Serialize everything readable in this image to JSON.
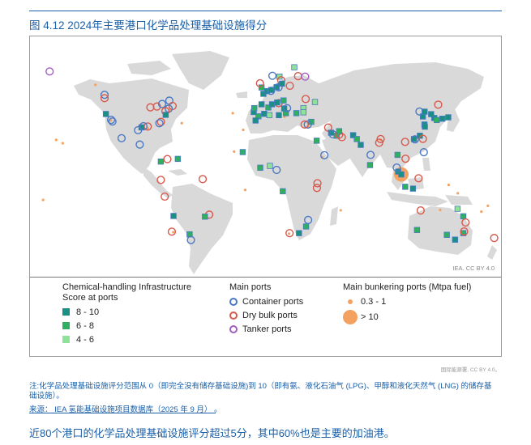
{
  "figure": {
    "title": "图 4.12 2024年主要港口化学品处理基础设施得分",
    "credit": "IEA. CC BY 4.0",
    "source_small": "国际能源署, CC BY 4.0。",
    "note": "注:化学品处理基础设施评分范围从 0（即完全没有储存基础设施)到 10（即有氨、液化石油气 (LPG)、甲醇和液化天然气 (LNG) 的储存基础设施）。",
    "source_label": "来源：",
    "source_link": "IEA 氢能基础设施项目数据库（2025 年 9 月）",
    "source_end": "。",
    "summary": "近80个港口的化学品处理基础设施评分超过5分，其中60%也是主要的加油港。"
  },
  "colors": {
    "land": "#d9d9d9",
    "score_high": "#1a8f83",
    "score_mid": "#2fb05e",
    "score_low": "#8fe29a",
    "container": "#4a79c4",
    "dry_bulk": "#d9584b",
    "tanker": "#a35cc4",
    "bunkering": "#f4a261"
  },
  "legend": {
    "score": {
      "title": "Chemical-handling Infrastructure Score at ports",
      "items": [
        "8 - 10",
        "6 - 8",
        "4 - 6"
      ]
    },
    "ports": {
      "title": "Main ports",
      "items": [
        "Container ports",
        "Dry bulk ports",
        "Tanker ports"
      ]
    },
    "bunkering": {
      "title": "Main bunkering ports (Mtpa fuel)",
      "items": [
        "0.3 - 1",
        "> 10"
      ]
    }
  },
  "map_markers": {
    "ports": [
      {
        "type": "tanker",
        "lon": -165,
        "lat": 63
      },
      {
        "type": "container",
        "lon": -123,
        "lat": 49
      },
      {
        "type": "dry_bulk",
        "lon": -123,
        "lat": 47
      },
      {
        "type": "score_high",
        "lon": -122,
        "lat": 37.5
      },
      {
        "type": "container",
        "lon": -118,
        "lat": 34
      },
      {
        "type": "container",
        "lon": -117,
        "lat": 33
      },
      {
        "type": "container",
        "lon": -110,
        "lat": 23
      },
      {
        "type": "dry_bulk",
        "lon": -88,
        "lat": 41.5
      },
      {
        "type": "dry_bulk",
        "lon": -83,
        "lat": 42
      },
      {
        "type": "container",
        "lon": -79,
        "lat": 43.5
      },
      {
        "type": "container",
        "lon": -73.5,
        "lat": 45.5
      },
      {
        "type": "dry_bulk",
        "lon": -71,
        "lat": 42.3
      },
      {
        "type": "container",
        "lon": -74,
        "lat": 40.7
      },
      {
        "type": "dry_bulk",
        "lon": -76.5,
        "lat": 39.2
      },
      {
        "type": "score_high",
        "lon": -76.3,
        "lat": 37
      },
      {
        "type": "dry_bulk",
        "lon": -79.9,
        "lat": 32.8
      },
      {
        "type": "container",
        "lon": -81.1,
        "lat": 32
      },
      {
        "type": "dry_bulk",
        "lon": -90,
        "lat": 30
      },
      {
        "type": "score_high",
        "lon": -94.8,
        "lat": 29.5
      },
      {
        "type": "container",
        "lon": -97.4,
        "lat": 27.8
      },
      {
        "type": "container",
        "lon": -93.3,
        "lat": 30.2
      },
      {
        "type": "container",
        "lon": -96.1,
        "lat": 19.2
      },
      {
        "type": "score_mid",
        "lon": -80,
        "lat": 9
      },
      {
        "type": "dry_bulk",
        "lon": -75,
        "lat": 10.5
      },
      {
        "type": "score_mid",
        "lon": -67,
        "lat": 10.6
      },
      {
        "type": "dry_bulk",
        "lon": -80,
        "lat": -2
      },
      {
        "type": "dry_bulk",
        "lon": -48,
        "lat": -1.5
      },
      {
        "type": "dry_bulk",
        "lon": -77,
        "lat": -12
      },
      {
        "type": "score_high",
        "lon": -70.3,
        "lat": -23.6
      },
      {
        "type": "dry_bulk",
        "lon": -71.6,
        "lat": -33
      },
      {
        "type": "dry_bulk",
        "lon": -43,
        "lat": -22.8
      },
      {
        "type": "score_mid",
        "lon": -46.3,
        "lat": -24
      },
      {
        "type": "score_mid",
        "lon": -58,
        "lat": -34.6
      },
      {
        "type": "container",
        "lon": -57,
        "lat": -38
      },
      {
        "type": "score_high",
        "lon": -9,
        "lat": 38.7
      },
      {
        "type": "score_mid",
        "lon": -8.6,
        "lat": 41
      },
      {
        "type": "score_high",
        "lon": -3,
        "lat": 43.3
      },
      {
        "type": "score_mid",
        "lon": -5.4,
        "lat": 36.1
      },
      {
        "type": "score_high",
        "lon": -1,
        "lat": 37.6
      },
      {
        "type": "score_mid",
        "lon": 2.2,
        "lat": 41.4
      },
      {
        "type": "score_high",
        "lon": 5,
        "lat": 43.3
      },
      {
        "type": "score_high",
        "lon": -1.6,
        "lat": 49.6
      },
      {
        "type": "score_high",
        "lon": 1.2,
        "lat": 51.2
      },
      {
        "type": "score_high",
        "lon": 4.4,
        "lat": 51.9
      },
      {
        "type": "container",
        "lon": 4.2,
        "lat": 51.4
      },
      {
        "type": "score_high",
        "lon": 8.5,
        "lat": 53.6
      },
      {
        "type": "container",
        "lon": 10,
        "lat": 53.5
      },
      {
        "type": "score_mid",
        "lon": -3,
        "lat": 53.4
      },
      {
        "type": "dry_bulk",
        "lon": -4.2,
        "lat": 55.9
      },
      {
        "type": "container",
        "lon": 5.3,
        "lat": 60.4
      },
      {
        "type": "score_low",
        "lon": 10.7,
        "lat": 59.9
      },
      {
        "type": "dry_bulk",
        "lon": 12,
        "lat": 57.7
      },
      {
        "type": "score_high",
        "lon": 12.6,
        "lat": 55.7
      },
      {
        "type": "dry_bulk",
        "lon": 18.6,
        "lat": 54.4
      },
      {
        "type": "dry_bulk",
        "lon": 24.9,
        "lat": 60.2
      },
      {
        "type": "tanker",
        "lon": 30.3,
        "lat": 59.9
      },
      {
        "type": "score_low",
        "lon": 22,
        "lat": 65.5
      },
      {
        "type": "dry_bulk",
        "lon": 10,
        "lat": 44
      },
      {
        "type": "score_high",
        "lon": 8.9,
        "lat": 44.4
      },
      {
        "type": "score_mid",
        "lon": 13.8,
        "lat": 45.6
      },
      {
        "type": "score_high",
        "lon": 14.3,
        "lat": 40.8
      },
      {
        "type": "score_mid",
        "lon": 15.6,
        "lat": 38
      },
      {
        "type": "container",
        "lon": 16.5,
        "lat": 41
      },
      {
        "type": "score_mid",
        "lon": 23.6,
        "lat": 38
      },
      {
        "type": "score_low",
        "lon": 29,
        "lat": 41
      },
      {
        "type": "score_low",
        "lon": 29,
        "lat": 38.5
      },
      {
        "type": "dry_bulk",
        "lon": 30.7,
        "lat": 46.5
      },
      {
        "type": "score_low",
        "lon": 37.8,
        "lat": 44.7
      },
      {
        "type": "score_mid",
        "lon": 35,
        "lat": 32.8
      },
      {
        "type": "container",
        "lon": 32.3,
        "lat": 31.2
      },
      {
        "type": "dry_bulk",
        "lon": 29.9,
        "lat": 31.2
      },
      {
        "type": "score_mid",
        "lon": 39.1,
        "lat": 21.5
      },
      {
        "type": "container",
        "lon": 45,
        "lat": 12.8
      },
      {
        "type": "score_low",
        "lon": 3,
        "lat": 36.8
      },
      {
        "type": "score_high",
        "lon": 10.2,
        "lat": 36.8
      },
      {
        "type": "score_high",
        "lon": -7.6,
        "lat": 33.6
      },
      {
        "type": "score_mid",
        "lon": -17.4,
        "lat": 14.7
      },
      {
        "type": "score_low",
        "lon": 3.4,
        "lat": 6.4
      },
      {
        "type": "score_mid",
        "lon": -4,
        "lat": 5.3
      },
      {
        "type": "dry_bulk",
        "lon": 39.7,
        "lat": -4
      },
      {
        "type": "dry_bulk",
        "lon": 39.3,
        "lat": -6.8
      },
      {
        "type": "container",
        "lon": 8.5,
        "lat": 4
      },
      {
        "type": "score_mid",
        "lon": 13.2,
        "lat": -8.8
      },
      {
        "type": "dry_bulk",
        "lon": 18.4,
        "lat": -33.9
      },
      {
        "type": "score_high",
        "lon": 25.6,
        "lat": -33.9
      },
      {
        "type": "score_mid",
        "lon": 31,
        "lat": -29.9
      },
      {
        "type": "container",
        "lon": 32.6,
        "lat": -26
      },
      {
        "type": "dry_bulk",
        "lon": 47.9,
        "lat": 29.4
      },
      {
        "type": "score_high",
        "lon": 50.1,
        "lat": 26.3
      },
      {
        "type": "container",
        "lon": 51.5,
        "lat": 25.3
      },
      {
        "type": "score_mid",
        "lon": 54.4,
        "lat": 24.5
      },
      {
        "type": "dry_bulk",
        "lon": 56.3,
        "lat": 25.1
      },
      {
        "type": "dry_bulk",
        "lon": 58.4,
        "lat": 23.6
      },
      {
        "type": "score_mid",
        "lon": 56.3,
        "lat": 27.2
      },
      {
        "type": "score_high",
        "lon": 67,
        "lat": 24.8
      },
      {
        "type": "score_high",
        "lon": 72.8,
        "lat": 19
      },
      {
        "type": "score_mid",
        "lon": 69.8,
        "lat": 22.5
      },
      {
        "type": "container",
        "lon": 80.3,
        "lat": 13
      },
      {
        "type": "dry_bulk",
        "lon": 86.9,
        "lat": 20.3
      },
      {
        "type": "dry_bulk",
        "lon": 88,
        "lat": 22.5
      },
      {
        "type": "score_mid",
        "lon": 79.9,
        "lat": 6.9
      },
      {
        "type": "score_high",
        "lon": 101.4,
        "lat": 3
      },
      {
        "type": "container",
        "lon": 100.3,
        "lat": 5.4
      },
      {
        "type": "score_high",
        "lon": 103.8,
        "lat": 1.3
      },
      {
        "type": "score_mid",
        "lon": 100.9,
        "lat": 13
      },
      {
        "type": "dry_bulk",
        "lon": 107,
        "lat": 10.7
      },
      {
        "type": "dry_bulk",
        "lon": 106.7,
        "lat": 20.8
      },
      {
        "type": "score_high",
        "lon": 113.5,
        "lat": 22.5
      },
      {
        "type": "container",
        "lon": 114.2,
        "lat": 22.3
      },
      {
        "type": "score_high",
        "lon": 118,
        "lat": 24.5
      },
      {
        "type": "score_high",
        "lon": 121.5,
        "lat": 31.2
      },
      {
        "type": "score_high",
        "lon": 121.8,
        "lat": 29.9
      },
      {
        "type": "score_high",
        "lon": 120.3,
        "lat": 36
      },
      {
        "type": "container",
        "lon": 117.7,
        "lat": 39
      },
      {
        "type": "score_high",
        "lon": 121.6,
        "lat": 38.9
      },
      {
        "type": "score_high",
        "lon": 129,
        "lat": 35.1
      },
      {
        "type": "score_high",
        "lon": 126.6,
        "lat": 37.4
      },
      {
        "type": "score_high",
        "lon": 135.2,
        "lat": 34.7
      },
      {
        "type": "score_high",
        "lon": 139.7,
        "lat": 35.5
      },
      {
        "type": "score_mid",
        "lon": 130.9,
        "lat": 33.9
      },
      {
        "type": "container",
        "lon": 121,
        "lat": 14.6
      },
      {
        "type": "dry_bulk",
        "lon": 120.3,
        "lat": 22.6
      },
      {
        "type": "score_mid",
        "lon": 106.8,
        "lat": -6.1
      },
      {
        "type": "score_high",
        "lon": 112.7,
        "lat": -7.2
      },
      {
        "type": "dry_bulk",
        "lon": 117,
        "lat": -1
      },
      {
        "type": "dry_bulk",
        "lon": 132,
        "lat": 43.1
      },
      {
        "type": "dry_bulk",
        "lon": 118.6,
        "lat": -20.3
      },
      {
        "type": "score_mid",
        "lon": 115.8,
        "lat": -32
      },
      {
        "type": "score_mid",
        "lon": 138.6,
        "lat": -34.9
      },
      {
        "type": "score_high",
        "lon": 144.9,
        "lat": -37.8
      },
      {
        "type": "score_mid",
        "lon": 151.2,
        "lat": -33.9
      },
      {
        "type": "score_mid",
        "lon": 151.2,
        "lat": -23.8
      },
      {
        "type": "dry_bulk",
        "lon": 152.9,
        "lat": -27.5
      },
      {
        "type": "score_low",
        "lon": 146.8,
        "lat": -19.3
      },
      {
        "type": "dry_bulk",
        "lon": 151.8,
        "lat": -32.9
      },
      {
        "type": "dry_bulk",
        "lon": 174.8,
        "lat": -36.8
      }
    ],
    "bunkering": [
      {
        "size": "large",
        "lon": 103.8,
        "lat": 1.3
      },
      {
        "size": "small",
        "lon": -73,
        "lat": 40
      },
      {
        "size": "small",
        "lon": -90,
        "lat": 29
      },
      {
        "size": "small",
        "lon": -79.5,
        "lat": 9.3
      },
      {
        "size": "small",
        "lon": -118.2,
        "lat": 33.7
      },
      {
        "size": "small",
        "lon": -64,
        "lat": 32
      },
      {
        "size": "small",
        "lon": -17,
        "lat": 28
      },
      {
        "size": "small",
        "lon": -25,
        "lat": 38
      },
      {
        "size": "small",
        "lon": -5.3,
        "lat": 36
      },
      {
        "size": "small",
        "lon": 14.5,
        "lat": 35.9
      },
      {
        "size": "small",
        "lon": 23.6,
        "lat": 37.9
      },
      {
        "size": "small",
        "lon": 32.5,
        "lat": 30
      },
      {
        "size": "small",
        "lon": 43.3,
        "lat": 11.6
      },
      {
        "size": "small",
        "lon": 56.3,
        "lat": 25.1
      },
      {
        "size": "small",
        "lon": 55.3,
        "lat": 25.3
      },
      {
        "size": "small",
        "lon": -46,
        "lat": -24.2
      },
      {
        "size": "small",
        "lon": 18,
        "lat": -34.2
      },
      {
        "size": "small",
        "lon": 57.5,
        "lat": -20.2
      },
      {
        "size": "small",
        "lon": 114.3,
        "lat": 22.1
      },
      {
        "size": "small",
        "lon": 121.8,
        "lat": 31
      },
      {
        "size": "small",
        "lon": 129.2,
        "lat": 35.2
      },
      {
        "size": "small",
        "lon": 133.5,
        "lat": -20
      },
      {
        "size": "small",
        "lon": 151.5,
        "lat": -34.2
      },
      {
        "size": "small",
        "lon": -70.5,
        "lat": -33.3
      },
      {
        "size": "small",
        "lon": -15.5,
        "lat": -8
      },
      {
        "size": "small",
        "lon": 80,
        "lat": 6.5
      },
      {
        "size": "small",
        "lon": 88,
        "lat": 22
      },
      {
        "size": "small",
        "lon": 147,
        "lat": -10
      },
      {
        "size": "small",
        "lon": -155,
        "lat": 20
      },
      {
        "size": "small",
        "lon": -170,
        "lat": -14
      },
      {
        "size": "small",
        "lon": -160,
        "lat": 22
      },
      {
        "size": "small",
        "lon": 165,
        "lat": -21
      },
      {
        "size": "small",
        "lon": 170,
        "lat": -17.5
      },
      {
        "size": "small",
        "lon": -24,
        "lat": 15
      },
      {
        "size": "small",
        "lon": 140,
        "lat": -5
      },
      {
        "size": "small",
        "lon": -130,
        "lat": 55
      }
    ]
  }
}
